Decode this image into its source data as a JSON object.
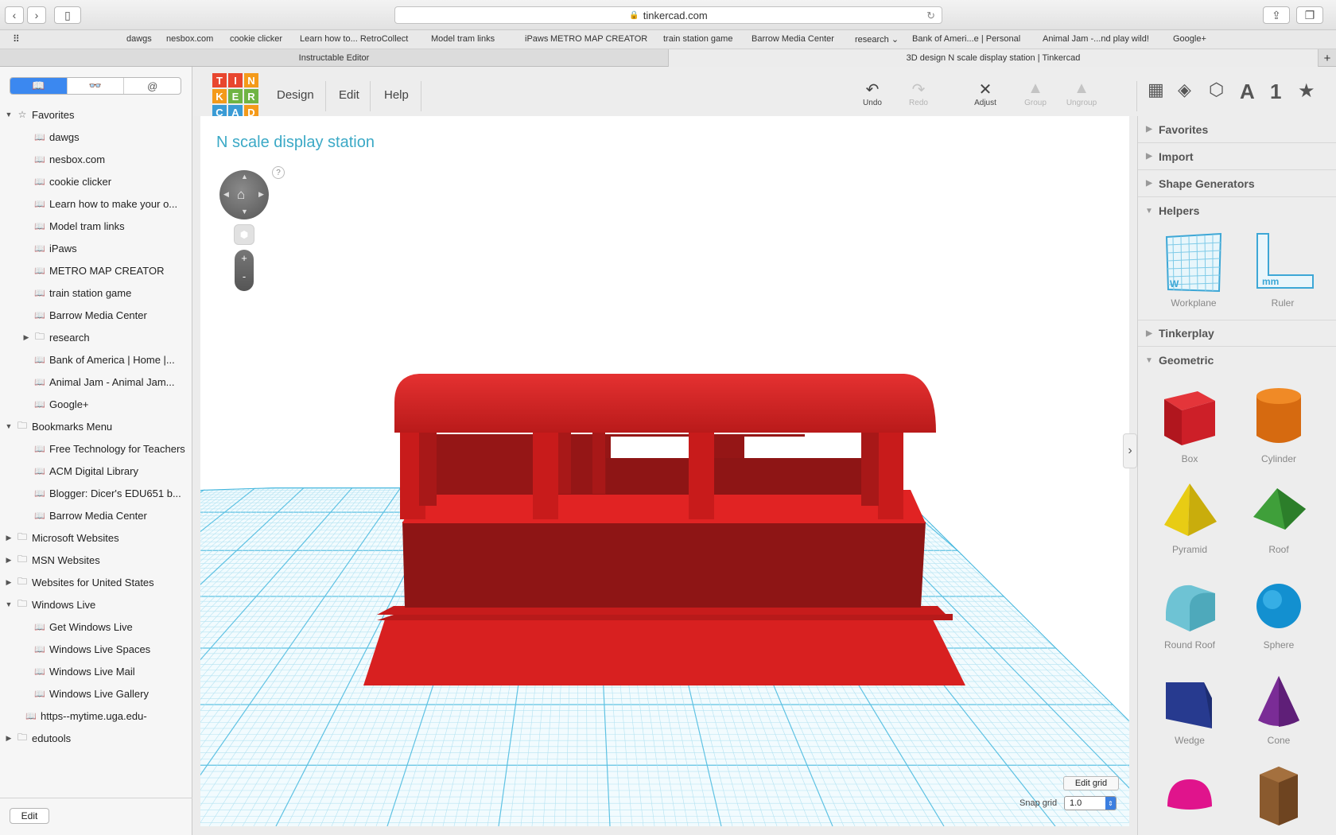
{
  "browser": {
    "url": "tinkercad.com",
    "favorites_bar": [
      "dawgs",
      "nesbox.com",
      "cookie clicker",
      "Learn how to... RetroCollect",
      "Model tram links",
      "iPaws",
      "METRO MAP CREATOR",
      "train station game",
      "Barrow Media Center",
      "research",
      "Bank of Ameri...e | Personal",
      "Animal Jam -...nd play wild!",
      "Google+"
    ],
    "tabs": [
      "Instructable Editor",
      "3D design N scale display station | Tinkercad"
    ]
  },
  "sidebar": {
    "segments": [
      "📖",
      "👓",
      "@"
    ],
    "items": [
      {
        "label": "Favorites",
        "type": "group-open",
        "indent": 0
      },
      {
        "label": "dawgs",
        "type": "book",
        "indent": 1
      },
      {
        "label": "nesbox.com",
        "type": "book",
        "indent": 1
      },
      {
        "label": "cookie clicker",
        "type": "book",
        "indent": 1
      },
      {
        "label": "Learn how to make your o...",
        "type": "book",
        "indent": 1
      },
      {
        "label": "Model tram links",
        "type": "book",
        "indent": 1
      },
      {
        "label": "iPaws",
        "type": "book",
        "indent": 1
      },
      {
        "label": "METRO MAP CREATOR",
        "type": "book",
        "indent": 1
      },
      {
        "label": "train station game",
        "type": "book",
        "indent": 1
      },
      {
        "label": "Barrow Media Center",
        "type": "book",
        "indent": 1
      },
      {
        "label": "research",
        "type": "folder-closed",
        "indent": 1
      },
      {
        "label": "Bank of America | Home |...",
        "type": "book",
        "indent": 1
      },
      {
        "label": "Animal Jam - Animal Jam...",
        "type": "book",
        "indent": 1
      },
      {
        "label": "Google+",
        "type": "book",
        "indent": 1
      },
      {
        "label": "Bookmarks Menu",
        "type": "folder-open",
        "indent": 0
      },
      {
        "label": "Free Technology for Teachers",
        "type": "book",
        "indent": 1
      },
      {
        "label": "ACM Digital Library",
        "type": "book",
        "indent": 1
      },
      {
        "label": "Blogger: Dicer's EDU651 b...",
        "type": "book",
        "indent": 1
      },
      {
        "label": "Barrow Media Center",
        "type": "book",
        "indent": 1
      },
      {
        "label": "Microsoft Websites",
        "type": "folder-closed",
        "indent": 0
      },
      {
        "label": "MSN Websites",
        "type": "folder-closed",
        "indent": 0
      },
      {
        "label": "Websites for United States",
        "type": "folder-closed",
        "indent": 0
      },
      {
        "label": "Windows Live",
        "type": "folder-open",
        "indent": 0
      },
      {
        "label": "Get Windows Live",
        "type": "book",
        "indent": 1
      },
      {
        "label": "Windows Live Spaces",
        "type": "book",
        "indent": 1
      },
      {
        "label": "Windows Live Mail",
        "type": "book",
        "indent": 1
      },
      {
        "label": "Windows Live Gallery",
        "type": "book",
        "indent": 1
      },
      {
        "label": "https--mytime.uga.edu-",
        "type": "book",
        "indent": 0.5
      },
      {
        "label": "edutools",
        "type": "folder-closed",
        "indent": 0
      }
    ],
    "edit_label": "Edit"
  },
  "tinkercad": {
    "logo_letters": [
      "T",
      "I",
      "N",
      "K",
      "E",
      "R",
      "C",
      "A",
      "D"
    ],
    "logo_colors": [
      "#e8462f",
      "#e8462f",
      "#f49a1a",
      "#f49a1a",
      "#6fb444",
      "#6fb444",
      "#3a9bd5",
      "#3a9bd5",
      "#f49a1a"
    ],
    "menus": [
      "Design",
      "Edit",
      "Help"
    ],
    "tools": {
      "undo": "Undo",
      "redo": "Redo",
      "adjust": "Adjust",
      "group": "Group",
      "ungroup": "Ungroup"
    },
    "view_icons": [
      "grid-view-icon",
      "box-view-icon",
      "perspective-cube-icon",
      "text-icon",
      "number-icon",
      "star-icon"
    ],
    "design_title": "N scale display station",
    "help_mark": "?",
    "zoom_in": "+",
    "zoom_out": "-",
    "edit_grid": "Edit grid",
    "snap_grid_label": "Snap grid",
    "snap_grid_value": "1.0",
    "panel": {
      "sections": [
        "Favorites",
        "Import",
        "Shape Generators",
        "Helpers",
        "Tinkerplay",
        "Geometric"
      ],
      "helpers": [
        "Workplane",
        "Ruler"
      ],
      "shapes": [
        "Box",
        "Cylinder",
        "Pyramid",
        "Roof",
        "Round Roof",
        "Sphere",
        "Wedge",
        "Cone"
      ]
    },
    "colors": {
      "accent": "#3ba9c6",
      "model": "#d82424",
      "grid": "#7fd0e8"
    }
  }
}
